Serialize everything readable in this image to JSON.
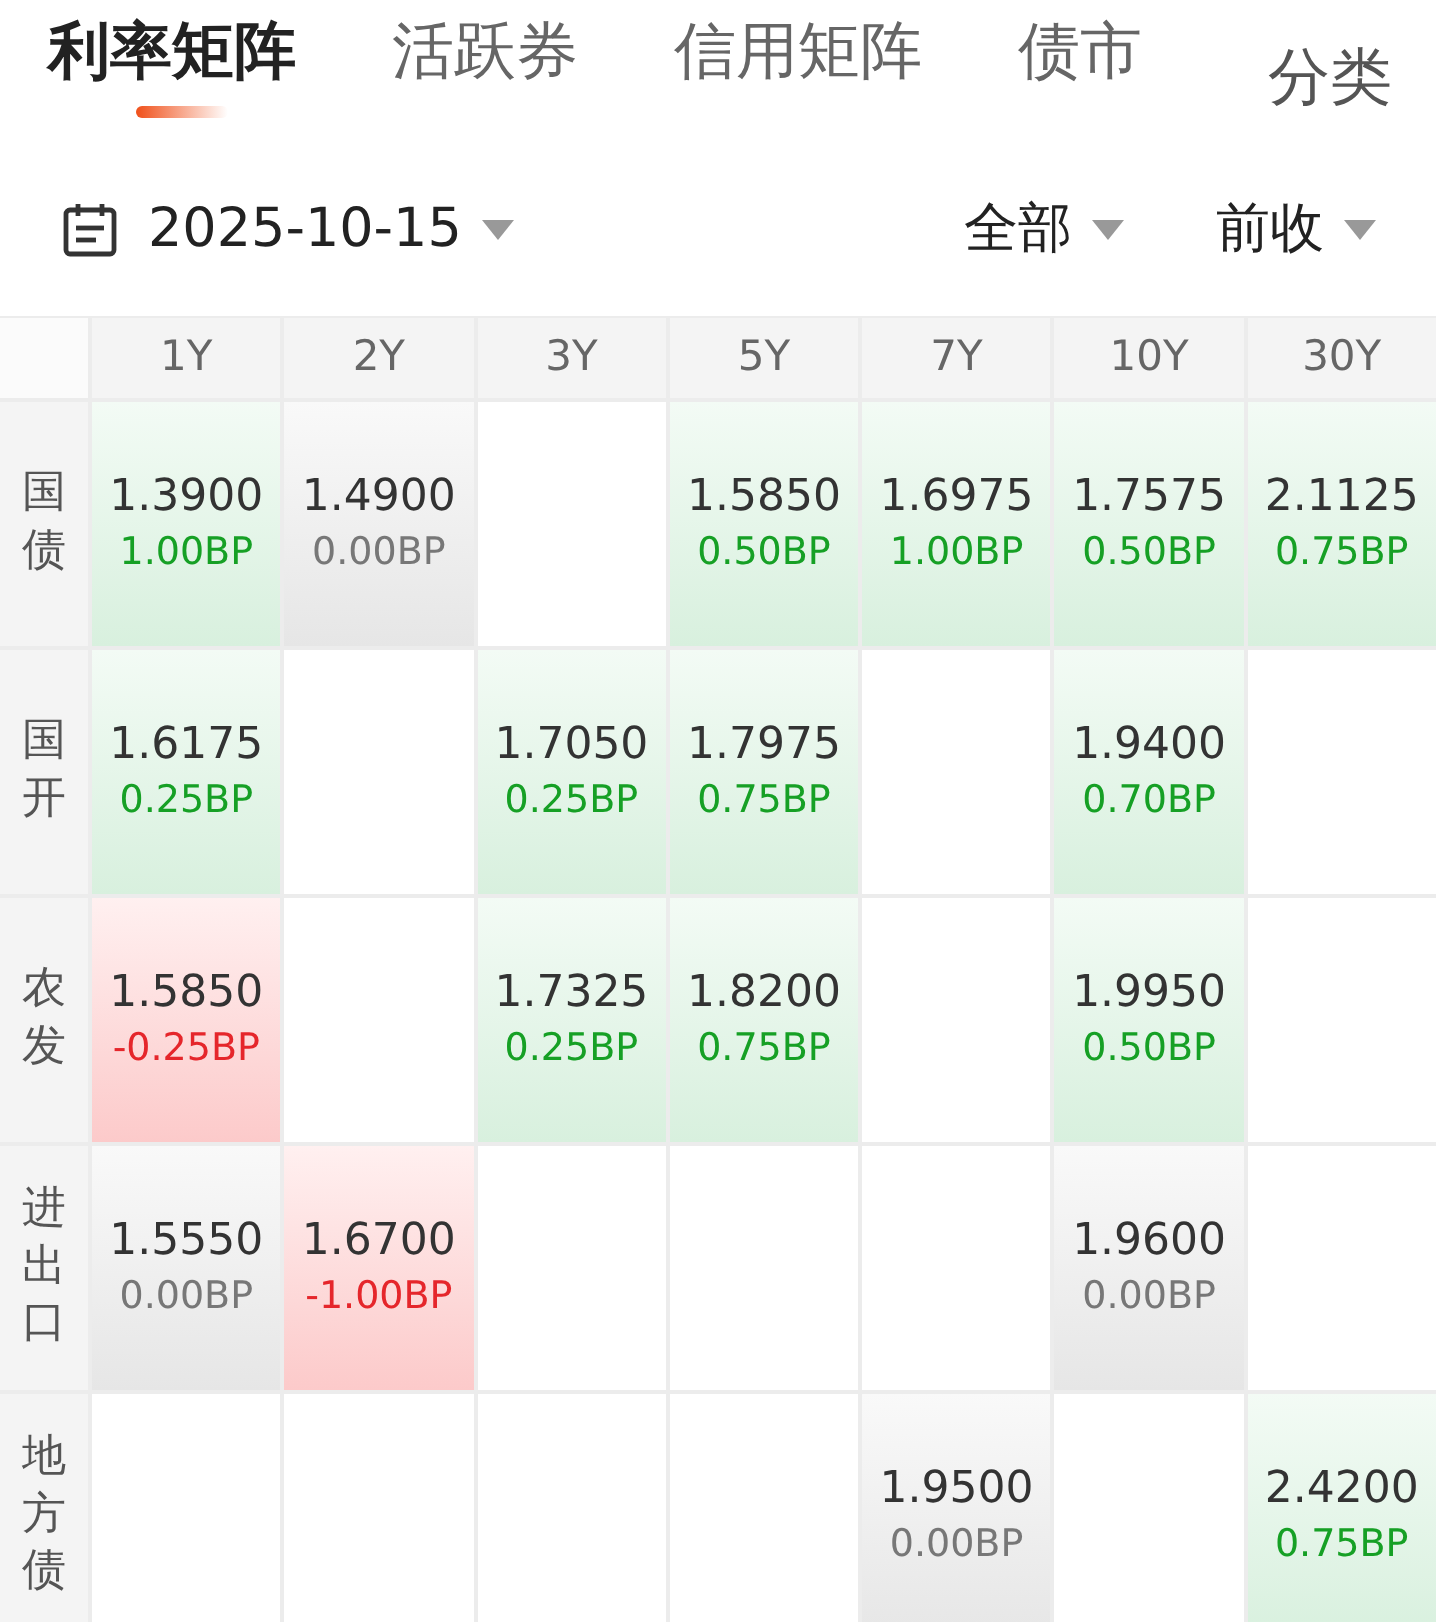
{
  "tabs": [
    {
      "label": "利率矩阵",
      "selected": true
    },
    {
      "label": "活跃券",
      "selected": false
    },
    {
      "label": "信用矩阵",
      "selected": false
    },
    {
      "label": "债市",
      "selected": false
    }
  ],
  "category_button": "分类",
  "filters": {
    "date": "2025-10-15",
    "scope": "全部",
    "price_basis": "前收"
  },
  "table": {
    "columns": [
      "1Y",
      "2Y",
      "3Y",
      "5Y",
      "7Y",
      "10Y",
      "30Y"
    ],
    "rows": [
      {
        "label": "国债",
        "cells": [
          {
            "yield": "1.3900",
            "change": "1.00BP",
            "kind": "up"
          },
          {
            "yield": "1.4900",
            "change": "0.00BP",
            "kind": "flat"
          },
          null,
          {
            "yield": "1.5850",
            "change": "0.50BP",
            "kind": "up"
          },
          {
            "yield": "1.6975",
            "change": "1.00BP",
            "kind": "up"
          },
          {
            "yield": "1.7575",
            "change": "0.50BP",
            "kind": "up"
          },
          {
            "yield": "2.1125",
            "change": "0.75BP",
            "kind": "up"
          }
        ]
      },
      {
        "label": "国开",
        "cells": [
          {
            "yield": "1.6175",
            "change": "0.25BP",
            "kind": "up"
          },
          null,
          {
            "yield": "1.7050",
            "change": "0.25BP",
            "kind": "up"
          },
          {
            "yield": "1.7975",
            "change": "0.75BP",
            "kind": "up"
          },
          null,
          {
            "yield": "1.9400",
            "change": "0.70BP",
            "kind": "up"
          },
          null
        ]
      },
      {
        "label": "农发",
        "cells": [
          {
            "yield": "1.5850",
            "change": "-0.25BP",
            "kind": "down"
          },
          null,
          {
            "yield": "1.7325",
            "change": "0.25BP",
            "kind": "up"
          },
          {
            "yield": "1.8200",
            "change": "0.75BP",
            "kind": "up"
          },
          null,
          {
            "yield": "1.9950",
            "change": "0.50BP",
            "kind": "up"
          },
          null
        ]
      },
      {
        "label": "进出口",
        "cells": [
          {
            "yield": "1.5550",
            "change": "0.00BP",
            "kind": "flat"
          },
          {
            "yield": "1.6700",
            "change": "-1.00BP",
            "kind": "down"
          },
          null,
          null,
          null,
          {
            "yield": "1.9600",
            "change": "0.00BP",
            "kind": "flat"
          },
          null
        ]
      },
      {
        "label": "地方债",
        "cells": [
          null,
          null,
          null,
          null,
          {
            "yield": "1.9500",
            "change": "0.00BP",
            "kind": "flat"
          },
          null,
          {
            "yield": "2.4200",
            "change": "0.75BP",
            "kind": "up"
          }
        ]
      }
    ]
  }
}
